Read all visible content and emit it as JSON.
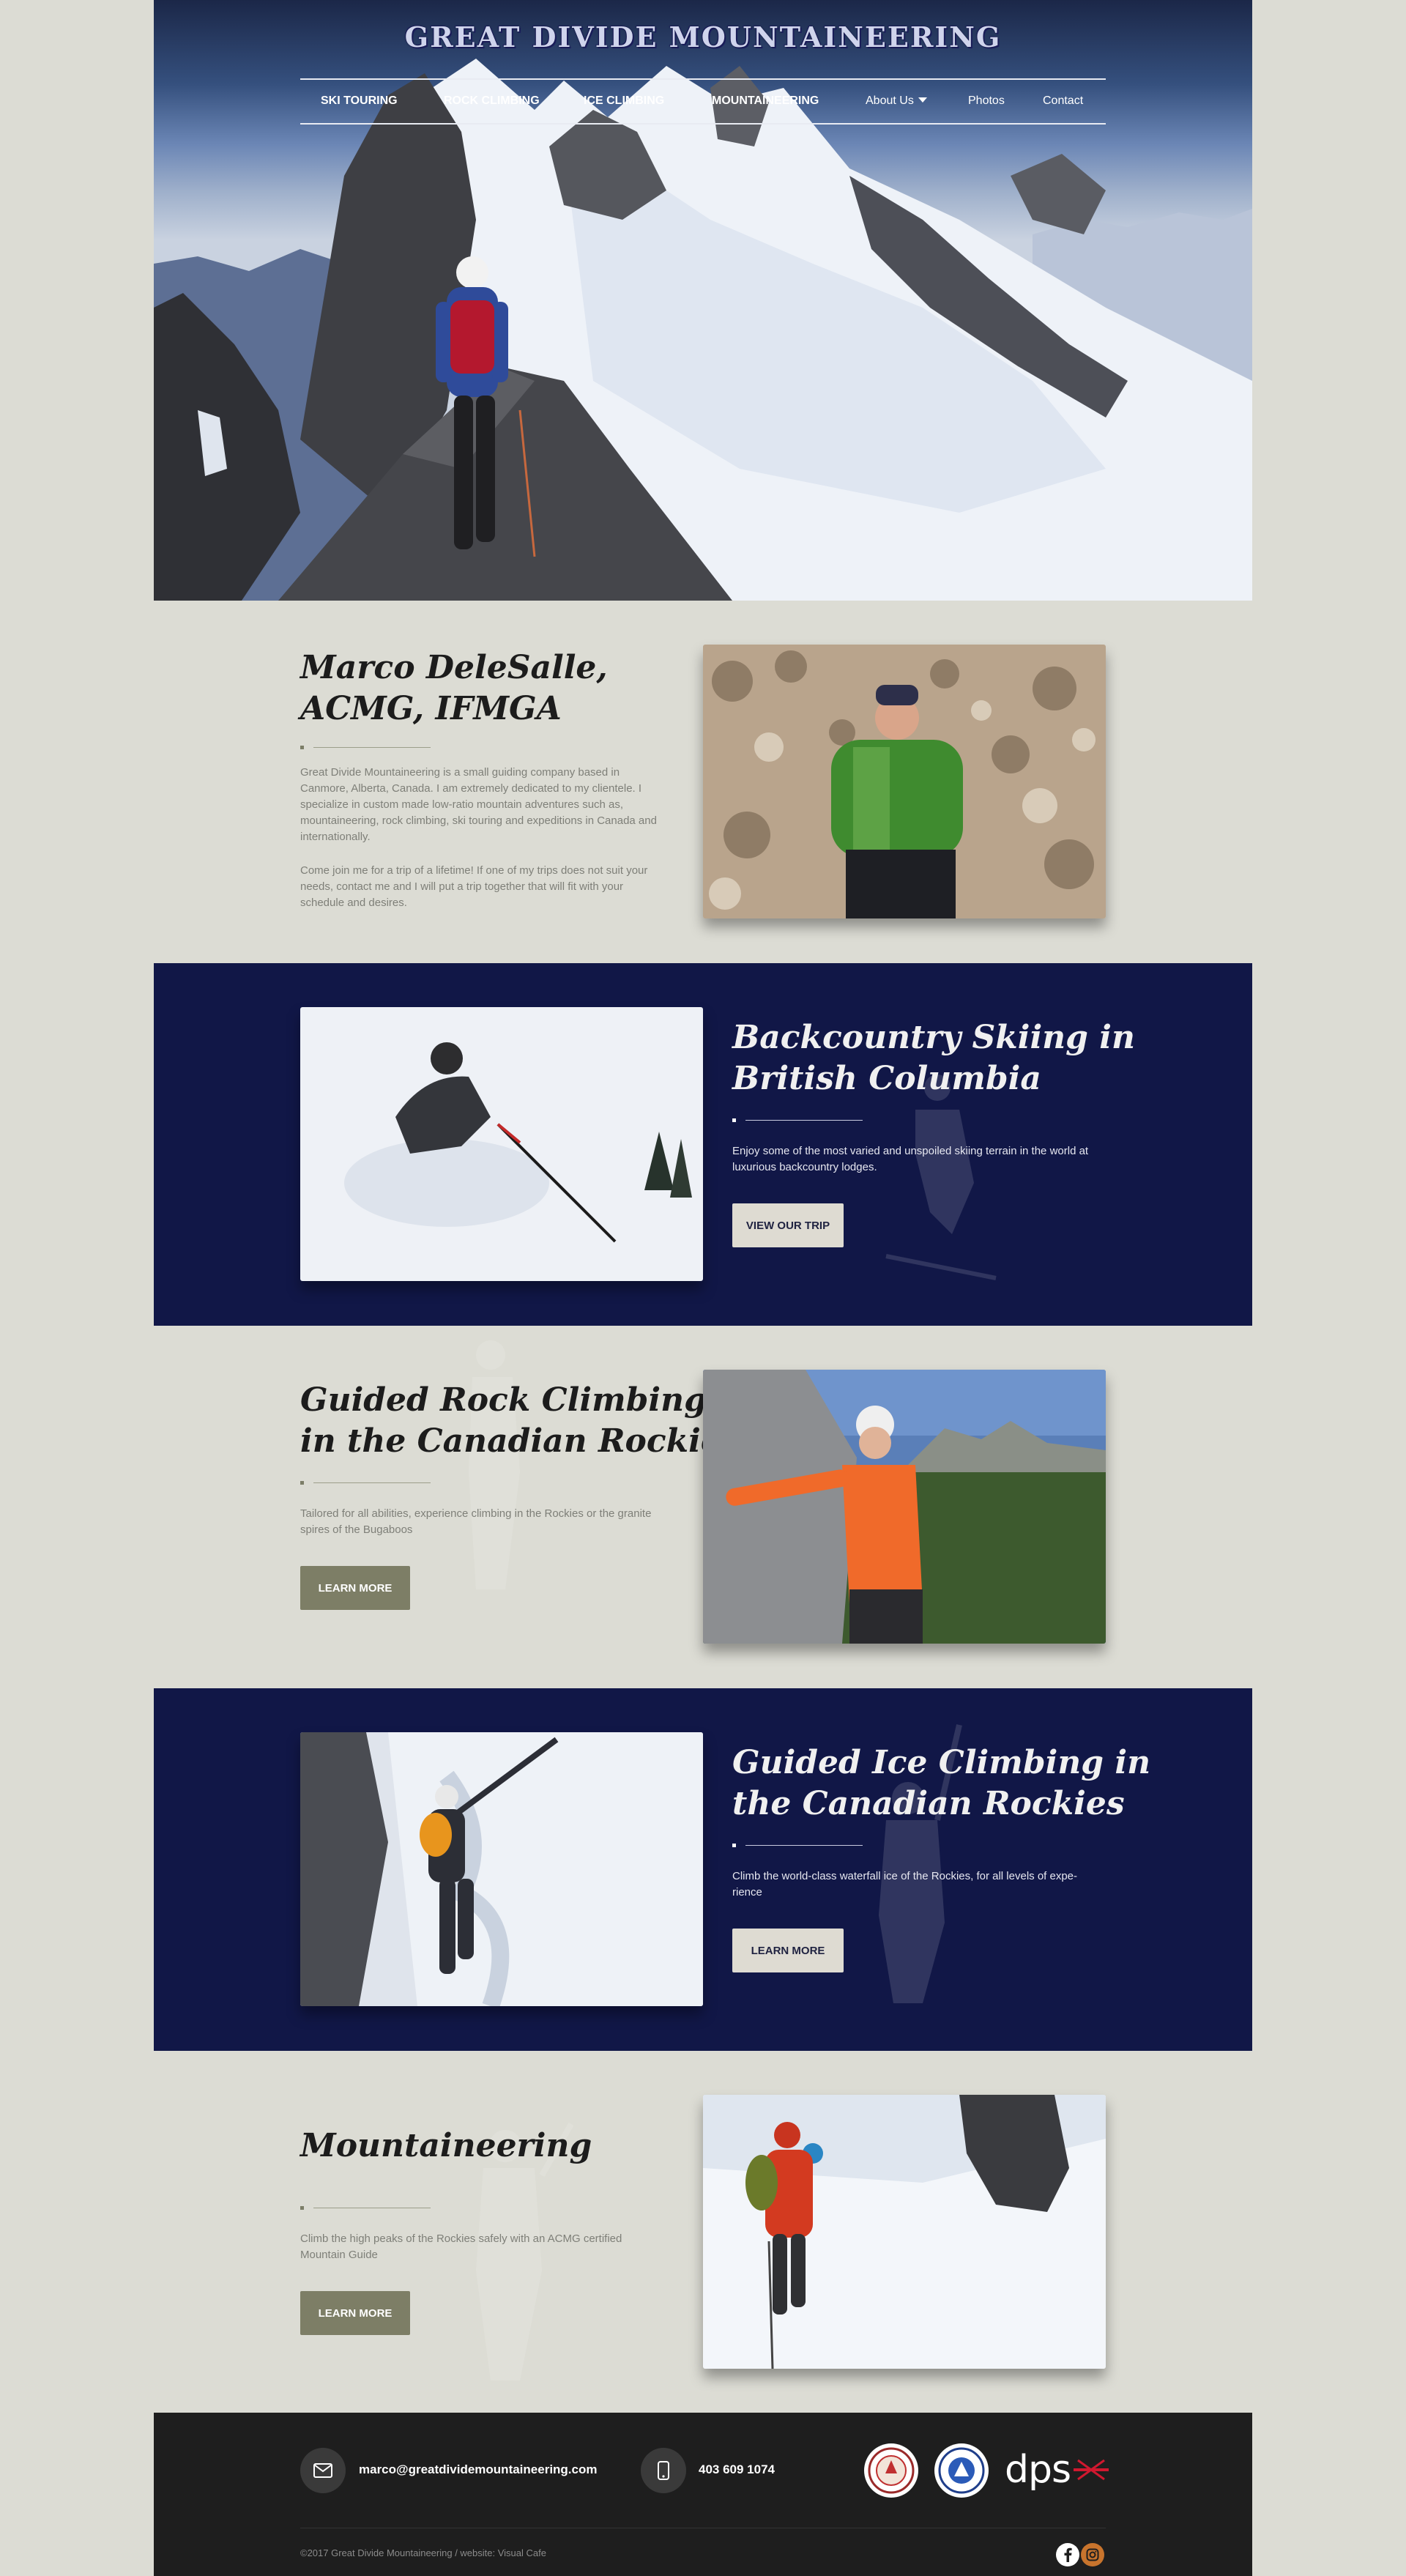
{
  "site": {
    "title": "GREAT DIVIDE MOUNTAINEERING"
  },
  "nav": {
    "items": [
      {
        "label": "SKI TOURING"
      },
      {
        "label": "ROCK CLIMBING"
      },
      {
        "label": "ICE CLIMBING"
      },
      {
        "label": "MOUNTAINEERING"
      },
      {
        "label": "About Us"
      },
      {
        "label": "Photos"
      },
      {
        "label": "Contact"
      }
    ]
  },
  "about": {
    "heading_line1": "Marco DeleSalle,",
    "heading_line2": "ACMG, IFMGA",
    "para1": "Great Divide Mountaineering is a small guiding company based in Canmore, Alberta, Canada. I am extremely dedicated to my clientele. I specialize in custom made low-ratio mountain adventures such as, mountaineering, rock climbing, ski touring and expeditions in Canada and internationally.",
    "para2": "Come join me for a trip of a lifetime! If one of my trips does not suit your needs, contact me and I will put a trip together that will fit with your schedule and desires."
  },
  "skiing": {
    "heading_line1": "Backcountry Skiing in",
    "heading_line2": "British Columbia",
    "text": "Enjoy some of the most varied and unspoiled skiing terrain in the world at luxurious backcountry lodges.",
    "button": "VIEW OUR TRIP"
  },
  "rock": {
    "heading_line1": "Guided Rock Climbing",
    "heading_line2": "in the Canadian Rockies",
    "text": "Tailored for all abilities, experience climbing in the Rockies or the granite spires of the Bugaboos",
    "button": "LEARN MORE"
  },
  "ice": {
    "heading_line1": "Guided Ice Climbing in",
    "heading_line2": "the Canadian Rockies",
    "text": "Climb the world-class waterfall ice of the Rockies, for all levels of expe-rience",
    "button": "LEARN MORE"
  },
  "mountaineering": {
    "heading": "Mountaineering",
    "text": "Climb the high peaks of the Rockies safely with an ACMG certified Mountain Guide",
    "button": "LEARN MORE"
  },
  "footer": {
    "email": "marco@greatdividemountaineering.com",
    "phone": "403 609 1074",
    "copyright": "©2017 Great Divide Mountaineering   /   website: Visual Cafe",
    "dps_logo": "dps"
  },
  "icons": {
    "email": "envelope-icon",
    "phone": "phone-icon",
    "facebook": "facebook-icon",
    "instagram": "instagram-icon"
  }
}
